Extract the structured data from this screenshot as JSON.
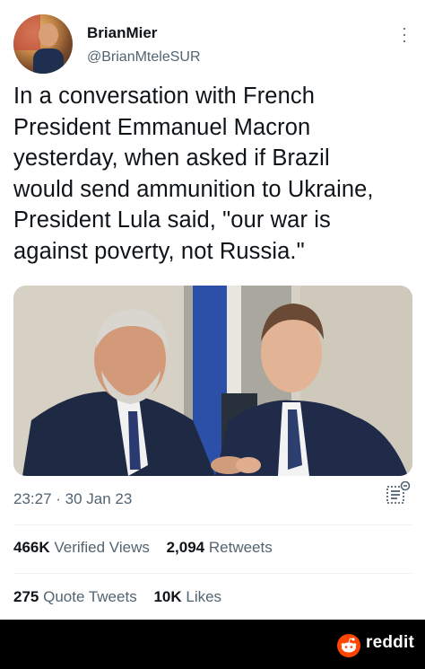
{
  "tweet": {
    "display_name": "BrianMier",
    "handle": "@BrianMteleSUR",
    "text": "In a conversation with French\nPresident  Emmanuel Macron\nyesterday, when asked if Brazil\nwould send ammunition to Ukraine,\nPresident Lula said,  \"our war is\nagainst poverty, not Russia.\"",
    "timestamp": "23:27 · 30 Jan 23"
  },
  "stats": {
    "views_count": "466K",
    "views_label": "Verified Views",
    "retweets_count": "2,094",
    "retweets_label": "Retweets",
    "quotes_count": "275",
    "quotes_label": "Quote Tweets",
    "likes_count": "10K",
    "likes_label": "Likes"
  },
  "footer": {
    "brand": "reddit"
  },
  "colors": {
    "text": "#0f1419",
    "muted": "#536471",
    "reddit_orange": "#ff4500"
  },
  "icons": [
    "more-options-icon",
    "reader-mode-icon",
    "reddit-logo-icon"
  ]
}
